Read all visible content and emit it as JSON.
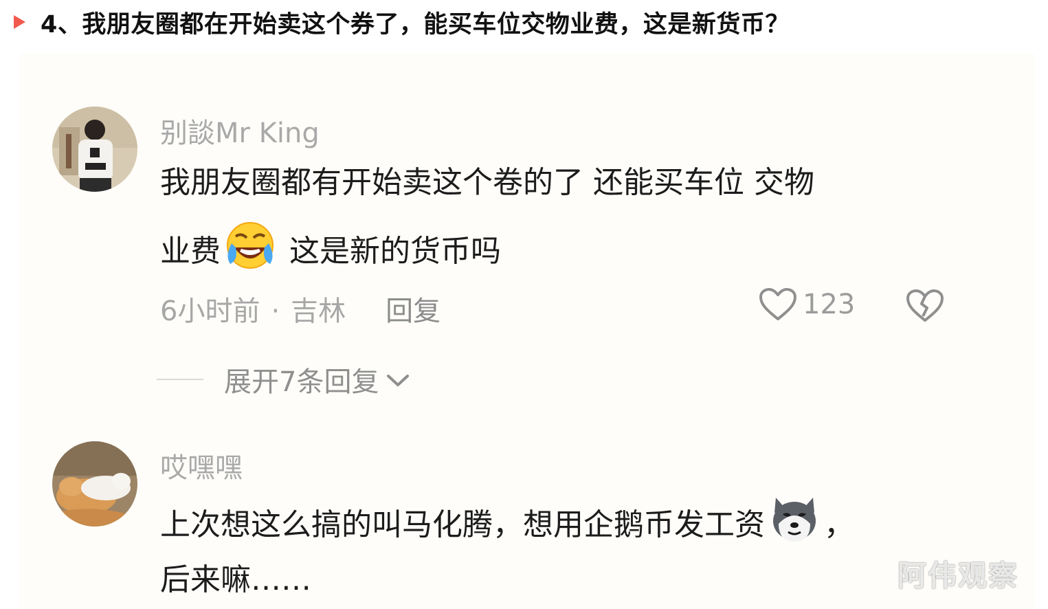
{
  "headline": {
    "number_and_title": "4、我朋友圈都在开始卖这个券了，能买车位交物业费，这是新货币？",
    "marker_color": "#f25a4e"
  },
  "comments": [
    {
      "username": "别談Mr King",
      "avatar_icon": "avatar-person-photo",
      "line1": "我朋友圈都有开始卖这个卷的了 还能买车位 交物",
      "line2_before": "业费",
      "line2_emoji": "crying-laughing-emoji",
      "line2_after": " 这是新的货币吗",
      "time": "6小时前",
      "location": "吉林",
      "reply_label": "回复",
      "like_count": "123",
      "like_icon": "heart-outline-icon",
      "dislike_icon": "broken-heart-icon"
    },
    {
      "username": "哎嘿嘿",
      "avatar_icon": "avatar-cat-photo",
      "line1_before": "上次想这么搞的叫马化腾，想用企鹅币发工资",
      "line1_emoji": "husky-dog-emoji",
      "line1_after": "，",
      "line2": "后来嘛……"
    }
  ],
  "expand_replies": {
    "label": "展开7条回复",
    "icon": "chevron-down-icon"
  },
  "watermark": "阿伟观察",
  "colors": {
    "background": "#fefdf9",
    "username": "#a9a9a9",
    "body_text": "#1c1c1c",
    "meta_text": "#a7a7a7"
  }
}
